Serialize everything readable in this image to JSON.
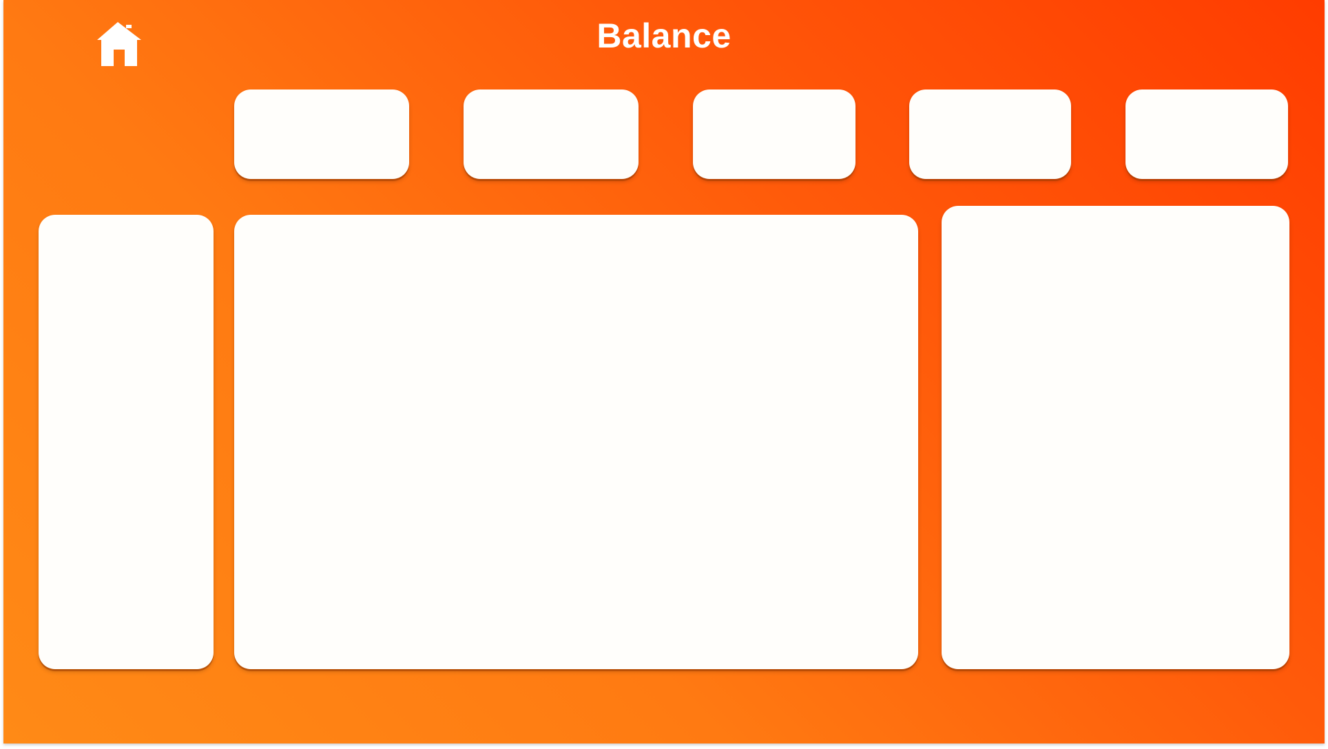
{
  "header": {
    "title": "Balance"
  },
  "icons": {
    "home": "home-icon"
  },
  "colors": {
    "background_start": "#ff8a16",
    "background_end": "#ff3c00",
    "card": "#fffefb",
    "title": "#ffffff"
  }
}
